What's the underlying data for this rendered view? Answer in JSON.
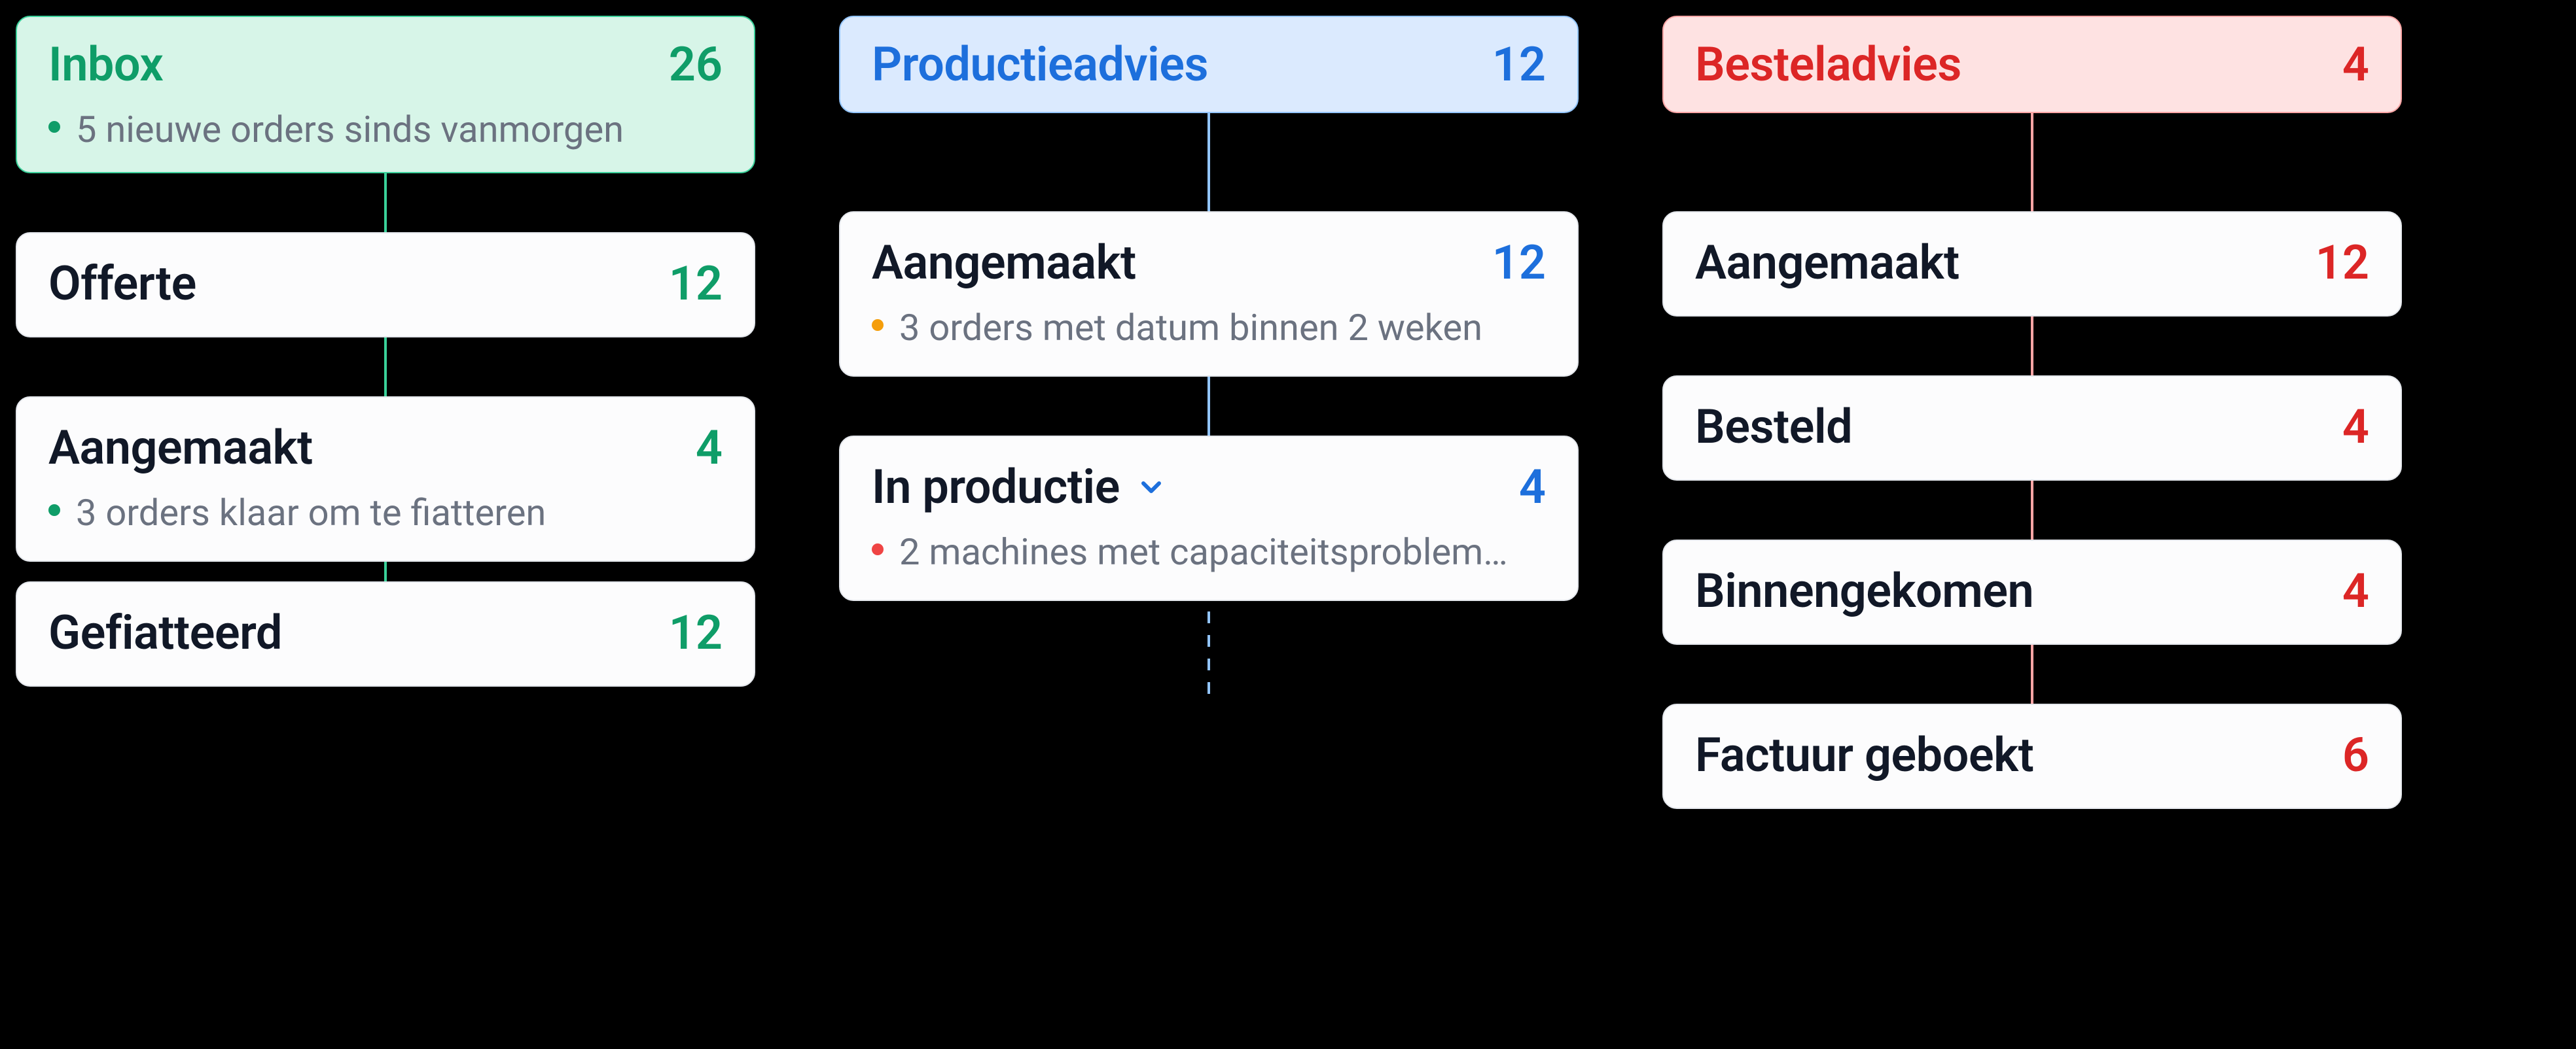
{
  "columns": [
    {
      "color": "green",
      "header": {
        "title": "Inbox",
        "count": 26,
        "note": "5 nieuwe orders sinds vanmorgen",
        "noteDot": "green"
      },
      "items": [
        {
          "title": "Offerte",
          "count": 12
        },
        {
          "title": "Aangemaakt",
          "count": 4,
          "note": "3 orders klaar om te fiatteren",
          "noteDot": "green"
        },
        {
          "title": "Gefiatteerd",
          "count": 12
        }
      ]
    },
    {
      "color": "blue",
      "header": {
        "title": "Productieadvies",
        "count": 12
      },
      "items": [
        {
          "title": "Aangemaakt",
          "count": 12,
          "note": "3 orders met datum binnen 2 weken",
          "noteDot": "orange"
        },
        {
          "title": "In productie",
          "count": 4,
          "note": "2 machines met capaciteitsproblem…",
          "noteDot": "red",
          "expandable": true
        }
      ],
      "trailingDashed": true
    },
    {
      "color": "red",
      "header": {
        "title": "Besteladvies",
        "count": 4
      },
      "items": [
        {
          "title": "Aangemaakt",
          "count": 12
        },
        {
          "title": "Besteld",
          "count": 4
        },
        {
          "title": "Binnengekomen",
          "count": 4
        },
        {
          "title": "Factuur geboekt",
          "count": 6
        }
      ]
    }
  ]
}
